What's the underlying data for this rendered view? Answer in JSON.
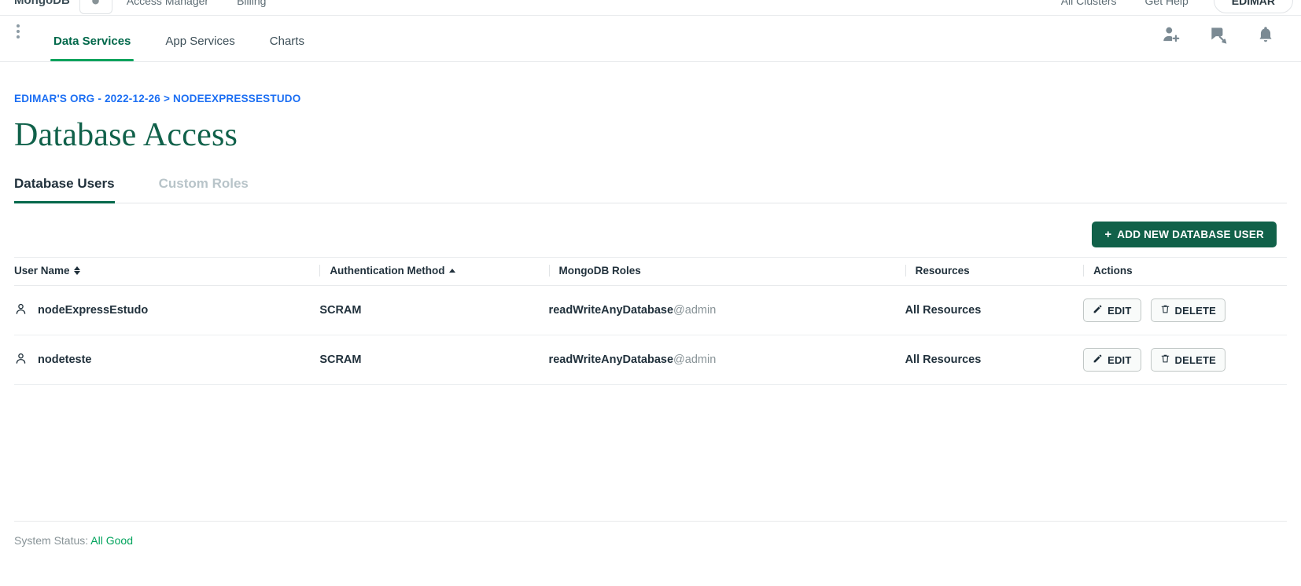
{
  "topbar": {
    "logo": "MongoDB",
    "leaf_icon": "leaf-icon",
    "links": [
      "Access Manager",
      "Billing"
    ],
    "right_links": [
      "All Clusters",
      "Get Help"
    ],
    "user_label": "EDIMAR"
  },
  "nav": {
    "kebab_icon": "kebab-menu-icon",
    "tabs": [
      {
        "label": "Data Services",
        "active": true
      },
      {
        "label": "App Services",
        "active": false
      },
      {
        "label": "Charts",
        "active": false
      }
    ],
    "icons": [
      {
        "name": "invite-user-icon"
      },
      {
        "name": "feedback-icon"
      },
      {
        "name": "notifications-bell-icon"
      }
    ]
  },
  "breadcrumb": "EDIMAR'S ORG - 2022-12-26 > NODEEXPRESSESTUDO",
  "title": "Database Access",
  "subtabs": [
    {
      "label": "Database Users",
      "active": true
    },
    {
      "label": "Custom Roles",
      "active": false
    }
  ],
  "toolbar": {
    "add_user_label": "ADD NEW DATABASE USER",
    "add_user_plus": "+"
  },
  "table": {
    "columns": [
      {
        "label": "User Name",
        "sort": "both"
      },
      {
        "label": "Authentication Method",
        "sort": "asc"
      },
      {
        "label": "MongoDB Roles",
        "sort": "none"
      },
      {
        "label": "Resources",
        "sort": "none"
      },
      {
        "label": "Actions",
        "sort": "none"
      }
    ],
    "rows": [
      {
        "user_icon": "user-icon",
        "username": "nodeExpressEstudo",
        "auth_method": "SCRAM",
        "role": "readWriteAnyDatabase",
        "role_db": "@admin",
        "resources": "All Resources",
        "edit_label": "EDIT",
        "delete_label": "DELETE"
      },
      {
        "user_icon": "user-icon",
        "username": "nodeteste",
        "auth_method": "SCRAM",
        "role": "readWriteAnyDatabase",
        "role_db": "@admin",
        "resources": "All Resources",
        "edit_label": "EDIT",
        "delete_label": "DELETE"
      }
    ]
  },
  "footer": {
    "status_label": "System Status:",
    "status_value": "All Good"
  },
  "colors": {
    "brand_green": "#00684a",
    "accent_green": "#00a35c",
    "button_green": "#116149",
    "link_blue": "#1b6ef3",
    "title_green": "#10614a",
    "muted": "#889397"
  }
}
